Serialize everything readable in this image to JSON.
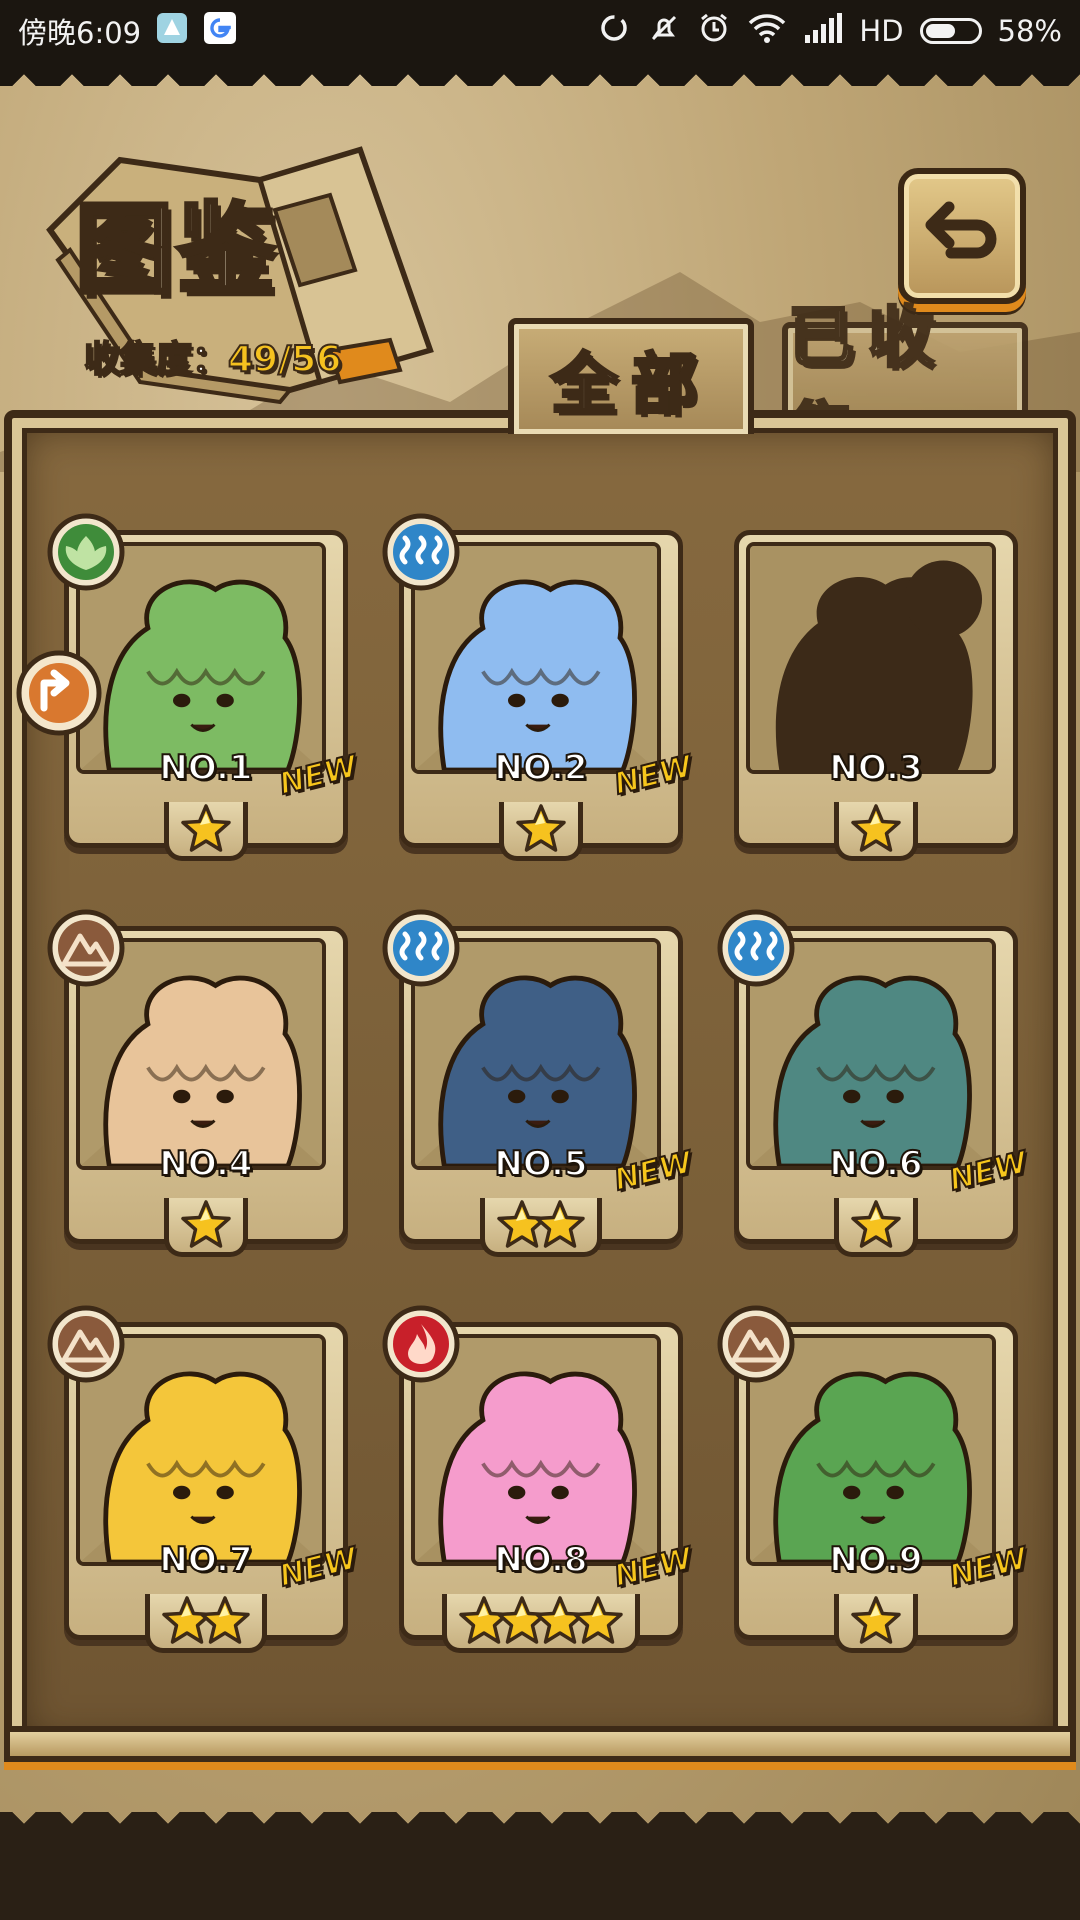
{
  "status_bar": {
    "time": "傍晚6:09",
    "network": "HD",
    "battery_percent": "58%",
    "battery_level": 0.58
  },
  "header": {
    "title": "图鉴",
    "collection_label": "收集度：",
    "collection_value": "49/56"
  },
  "tabs": [
    {
      "label": "全部",
      "active": true
    },
    {
      "label": "已收集",
      "active": false
    }
  ],
  "colors": {
    "accent_orange": "#e08a1c",
    "star_yellow": "#f6c21f",
    "new_yellow": "#f7c61c",
    "frame_dark": "#3d2a17",
    "panel_brown": "#7a5f38"
  },
  "cards": [
    {
      "number": "NO.1",
      "element": "leaf",
      "stars": 1,
      "is_new": true,
      "collected": true,
      "body_color": "#7dbb63",
      "new_label": "NEW"
    },
    {
      "number": "NO.2",
      "element": "water",
      "stars": 1,
      "is_new": true,
      "collected": true,
      "body_color": "#8fbcf0",
      "new_label": "NEW"
    },
    {
      "number": "NO.3",
      "element": "none",
      "stars": 1,
      "is_new": false,
      "collected": false,
      "body_color": "#3c2a18",
      "new_label": ""
    },
    {
      "number": "NO.4",
      "element": "earth",
      "stars": 1,
      "is_new": false,
      "collected": true,
      "body_color": "#e8c49a",
      "new_label": ""
    },
    {
      "number": "NO.5",
      "element": "water",
      "stars": 2,
      "is_new": true,
      "collected": true,
      "body_color": "#3f5f86",
      "new_label": "NEW"
    },
    {
      "number": "NO.6",
      "element": "water",
      "stars": 1,
      "is_new": true,
      "collected": true,
      "body_color": "#4f8882",
      "new_label": "NEW"
    },
    {
      "number": "NO.7",
      "element": "earth",
      "stars": 2,
      "is_new": true,
      "collected": true,
      "body_color": "#f4c63a",
      "new_label": "NEW"
    },
    {
      "number": "NO.8",
      "element": "fire",
      "stars": 4,
      "is_new": true,
      "collected": true,
      "body_color": "#f59ccc",
      "new_label": "NEW"
    },
    {
      "number": "NO.9",
      "element": "earth",
      "stars": 1,
      "is_new": true,
      "collected": true,
      "body_color": "#5aa552",
      "new_label": "NEW"
    }
  ],
  "icons": {
    "back": "return-arrow-icon",
    "side_badge": "direction-arrow-icon"
  }
}
